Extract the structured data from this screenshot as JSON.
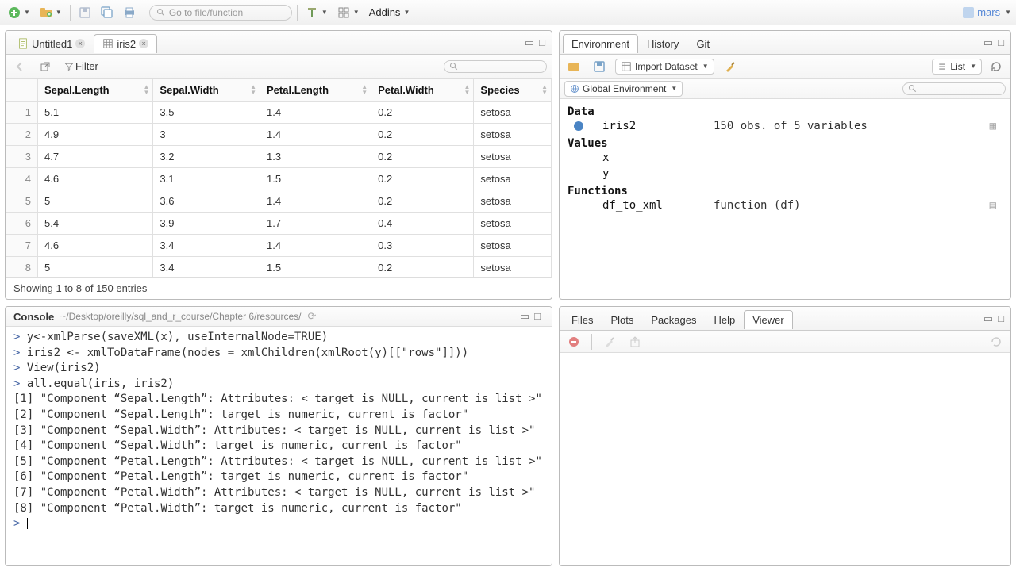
{
  "toolbar": {
    "goto_placeholder": "Go to file/function",
    "addins_label": "Addins",
    "user": "mars"
  },
  "source": {
    "tabs": [
      {
        "label": "Untitled1",
        "icon": "script"
      },
      {
        "label": "iris2",
        "icon": "table",
        "active": true
      }
    ],
    "filter_label": "Filter",
    "columns": [
      "Sepal.Length",
      "Sepal.Width",
      "Petal.Length",
      "Petal.Width",
      "Species"
    ],
    "rows": [
      [
        "5.1",
        "3.5",
        "1.4",
        "0.2",
        "setosa"
      ],
      [
        "4.9",
        "3",
        "1.4",
        "0.2",
        "setosa"
      ],
      [
        "4.7",
        "3.2",
        "1.3",
        "0.2",
        "setosa"
      ],
      [
        "4.6",
        "3.1",
        "1.5",
        "0.2",
        "setosa"
      ],
      [
        "5",
        "3.6",
        "1.4",
        "0.2",
        "setosa"
      ],
      [
        "5.4",
        "3.9",
        "1.7",
        "0.4",
        "setosa"
      ],
      [
        "4.6",
        "3.4",
        "1.4",
        "0.3",
        "setosa"
      ],
      [
        "5",
        "3.4",
        "1.5",
        "0.2",
        "setosa"
      ]
    ],
    "footer": "Showing 1 to 8 of 150 entries"
  },
  "env": {
    "tabs": [
      "Environment",
      "History",
      "Git"
    ],
    "import_label": "Import Dataset",
    "list_label": "List",
    "scope_label": "Global Environment",
    "data_head": "Data",
    "values_head": "Values",
    "functions_head": "Functions",
    "data_rows": [
      {
        "name": "iris2",
        "val": "150 obs. of 5 variables"
      }
    ],
    "value_rows": [
      {
        "name": "x"
      },
      {
        "name": "y"
      }
    ],
    "func_rows": [
      {
        "name": "df_to_xml",
        "val": "function (df)"
      }
    ]
  },
  "console": {
    "title": "Console",
    "path": "~/Desktop/oreilly/sql_and_r_course/Chapter 6/resources/",
    "lines": [
      {
        "p": "> ",
        "t": "y<-xmlParse(saveXML(x), useInternalNode=TRUE)"
      },
      {
        "p": "> ",
        "t": "iris2 <- xmlToDataFrame(nodes = xmlChildren(xmlRoot(y)[[\"rows\"]]))"
      },
      {
        "p": "> ",
        "t": "View(iris2)"
      },
      {
        "p": "> ",
        "t": "all.equal(iris, iris2)"
      },
      {
        "p": "",
        "t": "[1] \"Component “Sepal.Length”: Attributes: < target is NULL, current is list >\""
      },
      {
        "p": "",
        "t": "[2] \"Component “Sepal.Length”: target is numeric, current is factor\""
      },
      {
        "p": "",
        "t": "[3] \"Component “Sepal.Width”: Attributes: < target is NULL, current is list >\""
      },
      {
        "p": "",
        "t": "[4] \"Component “Sepal.Width”: target is numeric, current is factor\""
      },
      {
        "p": "",
        "t": "[5] \"Component “Petal.Length”: Attributes: < target is NULL, current is list >\""
      },
      {
        "p": "",
        "t": "[6] \"Component “Petal.Length”: target is numeric, current is factor\""
      },
      {
        "p": "",
        "t": "[7] \"Component “Petal.Width”: Attributes: < target is NULL, current is list >\""
      },
      {
        "p": "",
        "t": "[8] \"Component “Petal.Width”: target is numeric, current is factor\""
      }
    ]
  },
  "viewer": {
    "tabs": [
      "Files",
      "Plots",
      "Packages",
      "Help",
      "Viewer"
    ]
  }
}
